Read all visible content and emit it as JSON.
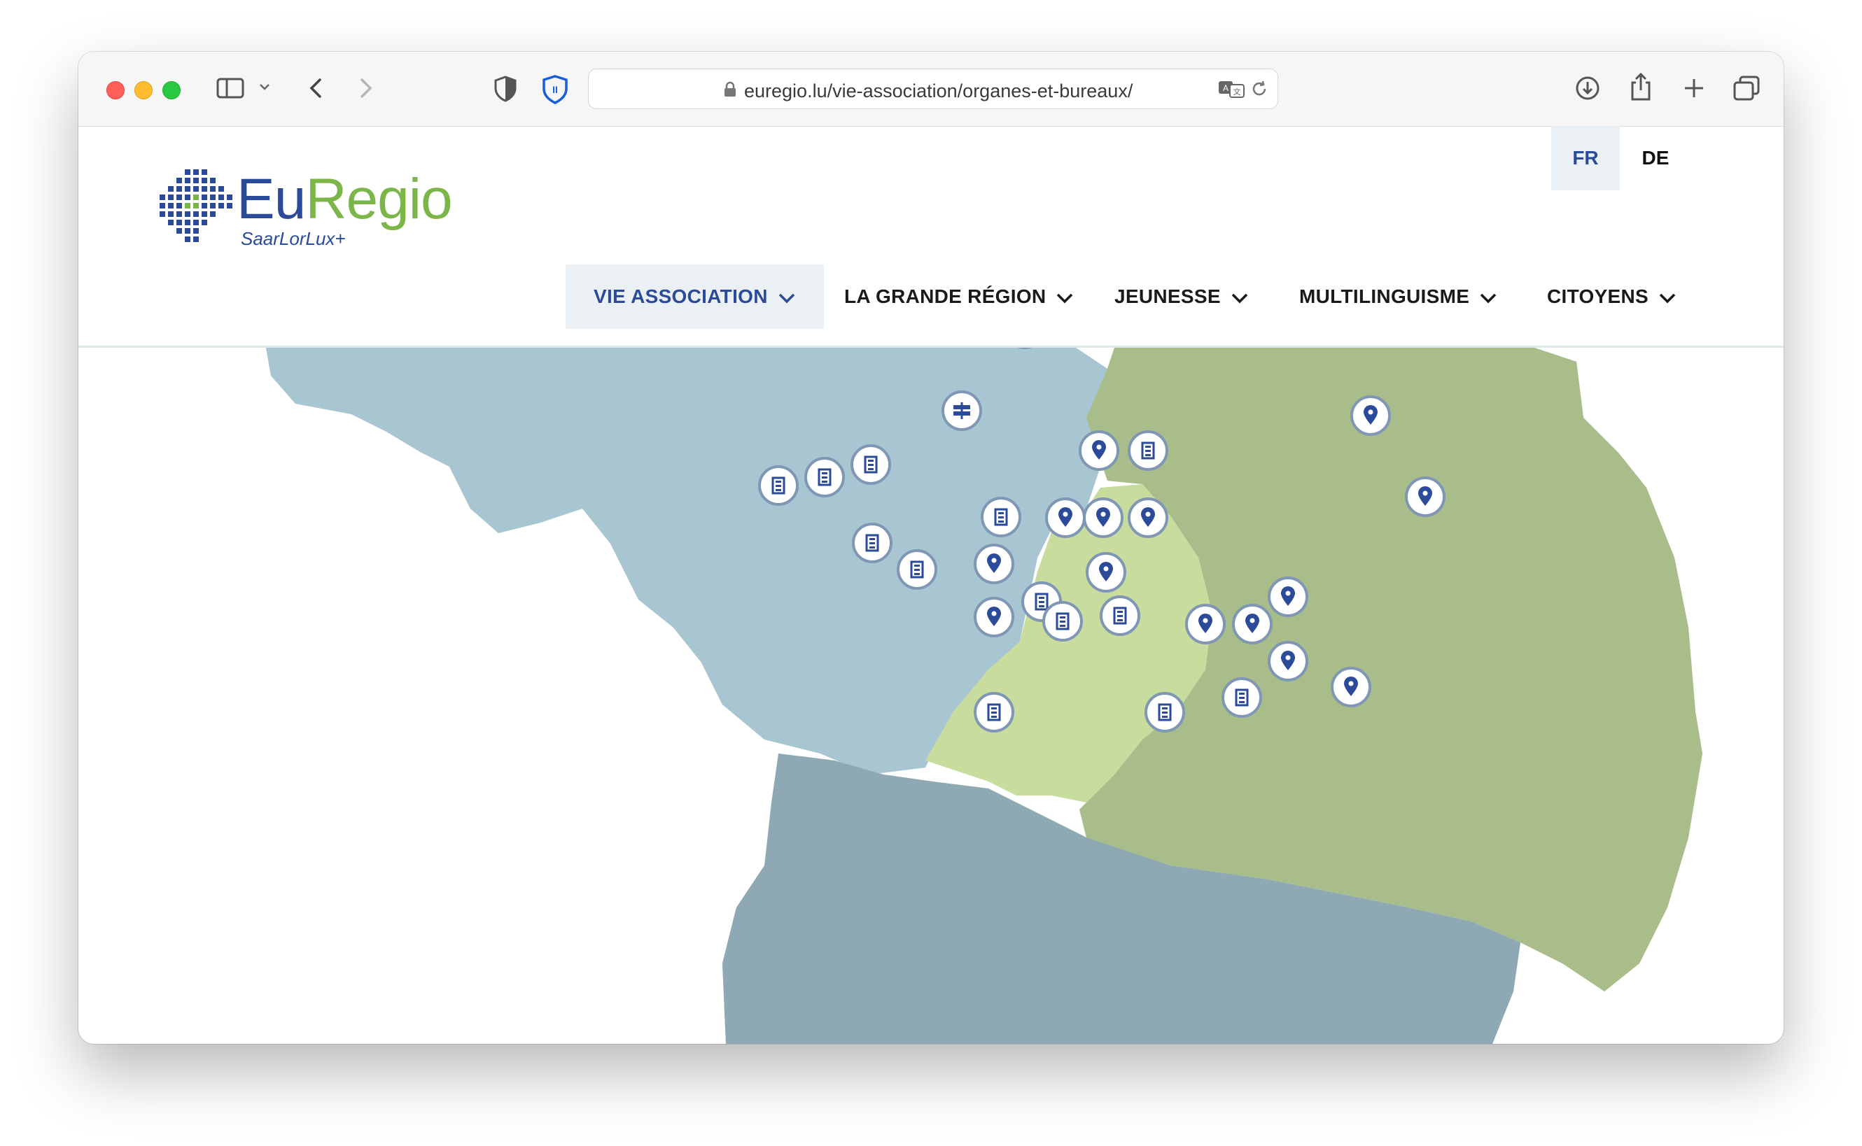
{
  "browser": {
    "url": "euregio.lu/vie-association/organes-et-bureaux/"
  },
  "site": {
    "logo_title_a": "Eu",
    "logo_title_b": "Regio",
    "logo_subtitle": "SaarLorLux+",
    "brand_blue": "#2b4a9a",
    "brand_green": "#7ab648"
  },
  "languages": [
    {
      "label": "FR",
      "active": true
    },
    {
      "label": "DE",
      "active": false
    }
  ],
  "nav": [
    {
      "label": "VIE ASSOCIATION",
      "active": true
    },
    {
      "label": "LA GRANDE RÉGION",
      "active": false
    },
    {
      "label": "JEUNESSE",
      "active": false
    },
    {
      "label": "MULTILINGUISME",
      "active": false
    },
    {
      "label": "CITOYENS",
      "active": false
    }
  ],
  "map": {
    "region_colors": {
      "wallonia": "#a8c6d2",
      "luxembourg": "#c8dc9e",
      "lorraine": "#8ea8b4",
      "rhineland": "#a9bd8a"
    },
    "markers": [
      {
        "kind": "pin"
      },
      {
        "kind": "pin"
      },
      {
        "kind": "pin"
      },
      {
        "kind": "pin"
      },
      {
        "kind": "sign"
      },
      {
        "kind": "sign"
      },
      {
        "kind": "building"
      },
      {
        "kind": "pin"
      },
      {
        "kind": "building"
      },
      {
        "kind": "building"
      },
      {
        "kind": "building"
      },
      {
        "kind": "building"
      },
      {
        "kind": "building"
      },
      {
        "kind": "pin"
      },
      {
        "kind": "pin"
      },
      {
        "kind": "pin"
      },
      {
        "kind": "pin"
      },
      {
        "kind": "pin"
      },
      {
        "kind": "pin"
      },
      {
        "kind": "pin"
      },
      {
        "kind": "building"
      },
      {
        "kind": "building"
      },
      {
        "kind": "pin"
      },
      {
        "kind": "pin"
      },
      {
        "kind": "pin"
      },
      {
        "kind": "pin"
      },
      {
        "kind": "building"
      },
      {
        "kind": "building"
      },
      {
        "kind": "building"
      },
      {
        "kind": "building"
      },
      {
        "kind": "building"
      },
      {
        "kind": "pin"
      },
      {
        "kind": "pin"
      }
    ]
  }
}
